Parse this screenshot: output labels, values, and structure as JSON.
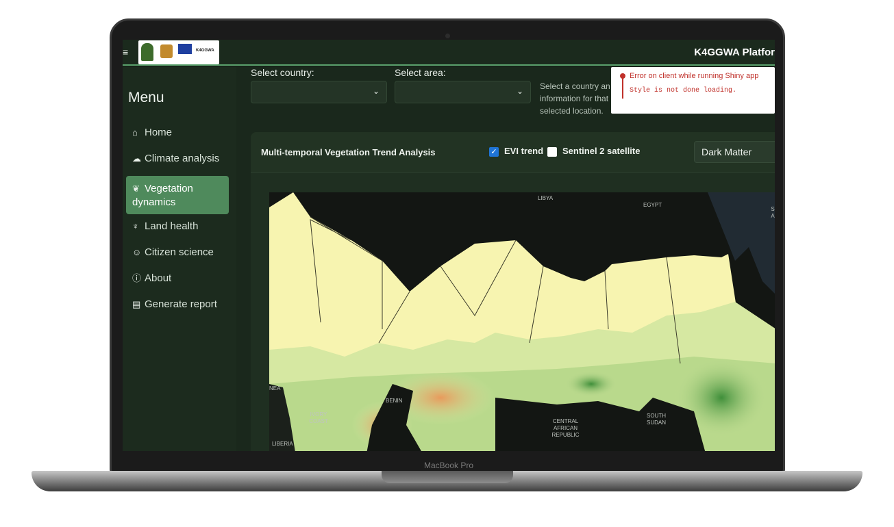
{
  "device": {
    "brand_label": "MacBook Pro"
  },
  "topbar": {
    "app_title": "K4GGWA Platfor",
    "menu_icon": "hamburger-icon"
  },
  "sidebar": {
    "menu_title": "Menu",
    "items": [
      {
        "icon": "home-icon",
        "glyph": "⌂",
        "label": "Home",
        "active": false
      },
      {
        "icon": "cloud-rain-icon",
        "glyph": "☁",
        "label": "Climate analysis",
        "active": false
      },
      {
        "icon": "leaf-icon",
        "glyph": "❦",
        "label": "Vegetation dynamics",
        "active": true
      },
      {
        "icon": "seedling-icon",
        "glyph": "♆",
        "label": "Land health",
        "active": false
      },
      {
        "icon": "users-icon",
        "glyph": "☺",
        "label": "Citizen science",
        "active": false
      },
      {
        "icon": "info-icon",
        "glyph": "ⓘ",
        "label": "About",
        "active": false
      },
      {
        "icon": "file-icon",
        "glyph": "▤",
        "label": "Generate report",
        "active": false
      }
    ]
  },
  "filters": {
    "country_label": "Select country:",
    "country_value": "",
    "area_label": "Select area:",
    "area_value": "",
    "hint": "Select a country an information for that selected location."
  },
  "toast": {
    "title": "Error on client while running Shiny app",
    "message": "Style is not done loading."
  },
  "panel": {
    "title": "Multi-temporal Vegetation Trend Analysis",
    "evi_label": "EVI trend",
    "evi_checked": true,
    "sentinel_label": "Sentinel 2 satellite",
    "sentinel_checked": false,
    "basemap_value": "Dark Matter"
  },
  "map": {
    "labels": {
      "libya": "LIBYA",
      "egypt": "EGYPT",
      "guinea": "NEA",
      "ivory_coast": "IVORY COAST",
      "benin": "BENIN",
      "liberia": "LIBERIA",
      "car": "CENTRAL AFRICAN REPUBLIC",
      "south_sudan": "SOUTH SUDAN",
      "edge": "S A"
    }
  },
  "colors": {
    "accent": "#4f8a5c",
    "error": "#c0312b",
    "checkbox": "#1f74d6"
  }
}
